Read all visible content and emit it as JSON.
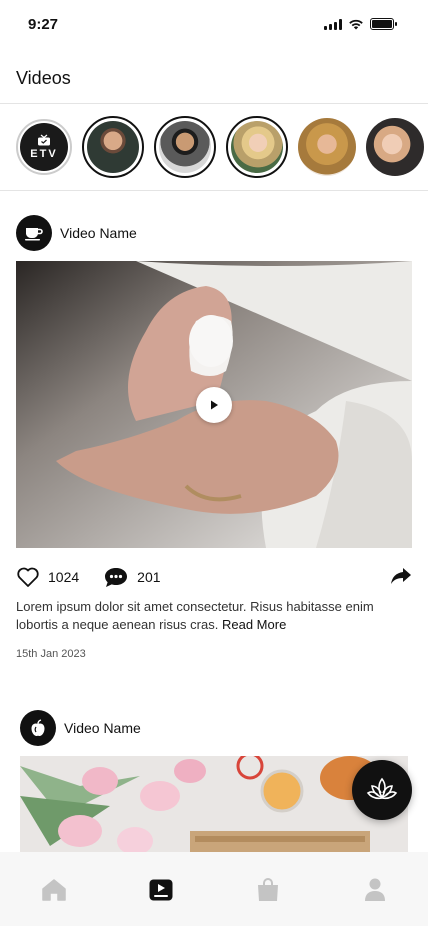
{
  "status_bar": {
    "time": "9:27"
  },
  "header": {
    "title": "Videos"
  },
  "stories": [
    {
      "type": "channel",
      "label": "ETV",
      "icon": "tv-icon"
    },
    {
      "type": "person",
      "name": "story-person-1"
    },
    {
      "type": "person",
      "name": "story-person-2"
    },
    {
      "type": "person",
      "name": "story-person-3"
    },
    {
      "type": "person",
      "name": "story-person-4"
    },
    {
      "type": "person",
      "name": "story-person-5"
    }
  ],
  "posts": [
    {
      "channel_icon": "cup-icon",
      "name": "Video Name",
      "likes": "1024",
      "comments": "201",
      "caption": "Lorem ipsum dolor sit amet consectetur. Risus habitasse enim lobortis a neque aenean risus cras.",
      "read_more": "Read More",
      "date": "15th Jan 2023"
    },
    {
      "channel_icon": "apple-icon",
      "name": "Video Name"
    }
  ],
  "bottom_nav": [
    {
      "name": "home",
      "icon": "home-icon",
      "active": false
    },
    {
      "name": "videos",
      "icon": "video-icon",
      "active": true
    },
    {
      "name": "shop",
      "icon": "bag-icon",
      "active": false
    },
    {
      "name": "profile",
      "icon": "person-icon",
      "active": false
    }
  ],
  "colors": {
    "accent": "#111111",
    "inactive_icon": "#c4c4c4",
    "nav_background": "#f7f7f7"
  }
}
